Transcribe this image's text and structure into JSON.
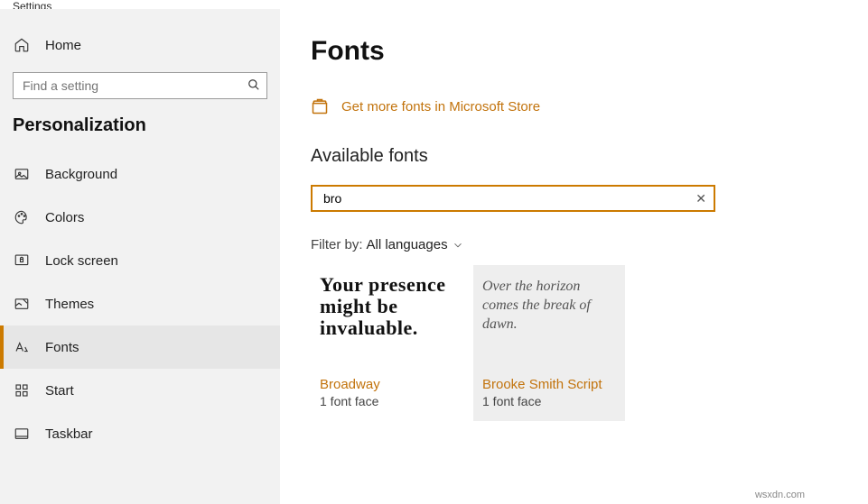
{
  "window": {
    "title": "Settings"
  },
  "sidebar": {
    "home": "Home",
    "searchPlaceholder": "Find a setting",
    "heading": "Personalization",
    "items": [
      {
        "label": "Background",
        "icon": "image"
      },
      {
        "label": "Colors",
        "icon": "palette"
      },
      {
        "label": "Lock screen",
        "icon": "lock"
      },
      {
        "label": "Themes",
        "icon": "brush"
      },
      {
        "label": "Fonts",
        "icon": "font",
        "active": true
      },
      {
        "label": "Start",
        "icon": "grid"
      },
      {
        "label": "Taskbar",
        "icon": "taskbar"
      }
    ]
  },
  "page": {
    "title": "Fonts",
    "storeLink": "Get more fonts in Microsoft Store",
    "availableHeading": "Available fonts",
    "searchValue": "bro",
    "filter": {
      "label": "Filter by:",
      "value": "All languages"
    },
    "cards": [
      {
        "sample": "Your presence might be invaluable.",
        "name": "Broadway",
        "faces": "1 font face",
        "style": "broadway"
      },
      {
        "sample": "Over the horizon comes the break of dawn.",
        "name": "Brooke Smith Script",
        "faces": "1 font face",
        "style": "script",
        "selected": true
      }
    ]
  },
  "credit": "wsxdn.com"
}
